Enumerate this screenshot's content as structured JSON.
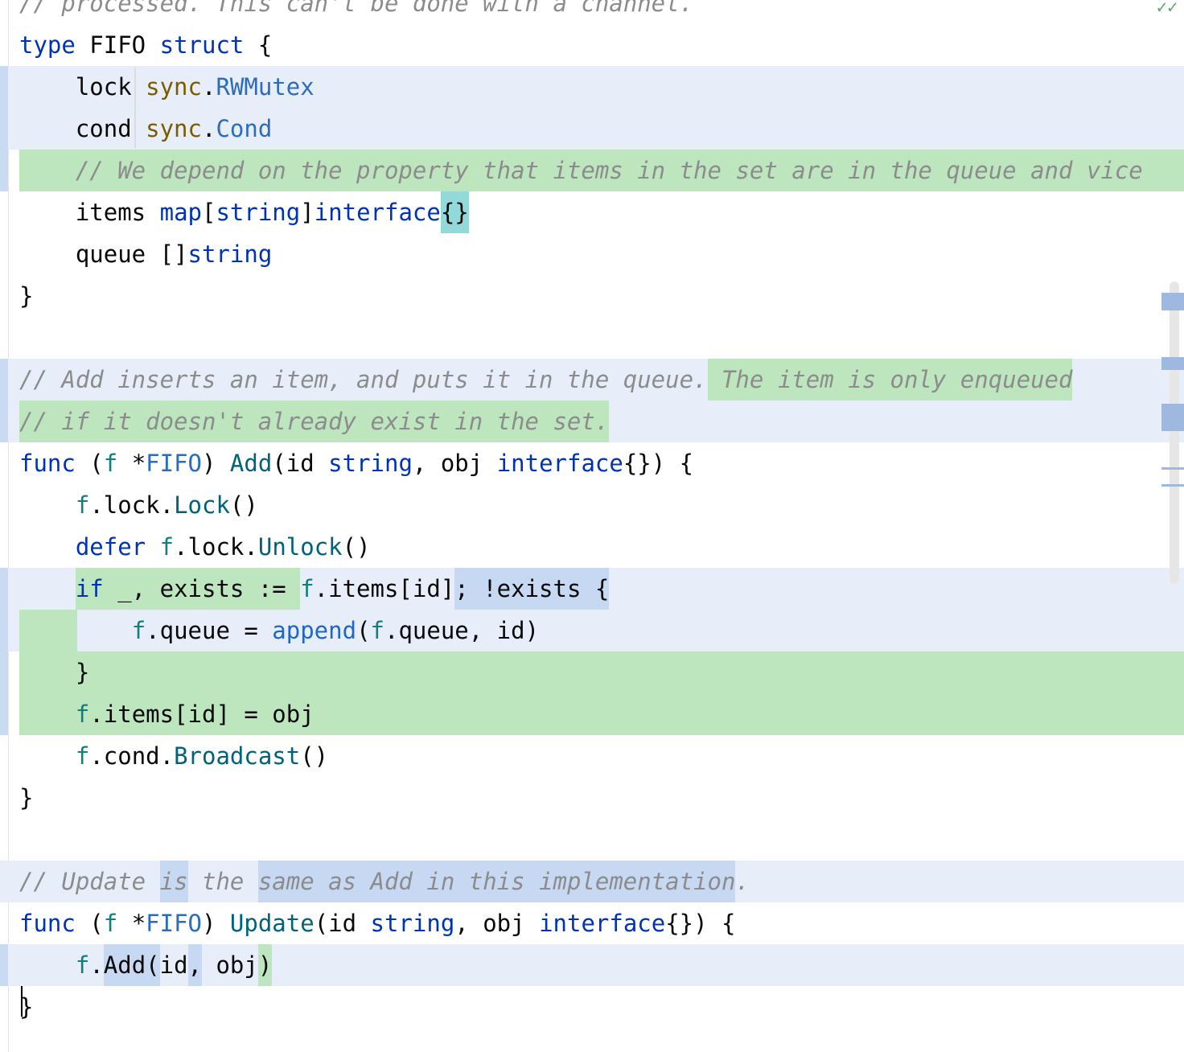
{
  "editor": {
    "status": "✓✓",
    "lines": [
      {
        "id": "l00",
        "tokens": [
          {
            "t": "// processed. This can't be done with a channel.",
            "c": "cm"
          }
        ]
      },
      {
        "id": "l01",
        "tokens": [
          {
            "t": "type",
            "c": "kw"
          },
          {
            "t": " FIFO "
          },
          {
            "t": "struct",
            "c": "kw"
          },
          {
            "t": " {"
          }
        ]
      },
      {
        "id": "l02",
        "tokens": [
          {
            "t": "    lock "
          },
          {
            "t": "sync",
            "c": "pk"
          },
          {
            "t": "."
          },
          {
            "t": "RWMutex",
            "c": "ty"
          }
        ]
      },
      {
        "id": "l03",
        "tokens": [
          {
            "t": "    cond "
          },
          {
            "t": "sync",
            "c": "pk"
          },
          {
            "t": "."
          },
          {
            "t": "Cond",
            "c": "ty"
          }
        ]
      },
      {
        "id": "l04",
        "tokens": [
          {
            "t": "    "
          },
          {
            "t": "// We depend on the property that items in the set are in the queue and vice",
            "c": "cm"
          }
        ]
      },
      {
        "id": "l05",
        "tokens": [
          {
            "t": "    items "
          },
          {
            "t": "map",
            "c": "kw"
          },
          {
            "t": "["
          },
          {
            "t": "string",
            "c": "kw"
          },
          {
            "t": "]"
          },
          {
            "t": "interface",
            "c": "kw"
          },
          {
            "t": "{}",
            "c": "hl-t"
          }
        ]
      },
      {
        "id": "l06",
        "tokens": [
          {
            "t": "    queue []"
          },
          {
            "t": "string",
            "c": "kw"
          }
        ]
      },
      {
        "id": "l07",
        "tokens": [
          {
            "t": "}"
          }
        ]
      },
      {
        "id": "l08",
        "tokens": [
          {
            "t": ""
          }
        ]
      },
      {
        "id": "l09",
        "tokens": [
          {
            "t": "// Add inserts an item, and puts it in the queue.",
            "c": "cm"
          },
          {
            "t": " The item is only enqueued",
            "c": "cm hl-g"
          }
        ]
      },
      {
        "id": "l10",
        "tokens": [
          {
            "t": "// if it doesn't already exist in the set.",
            "c": "cm hl-g"
          }
        ]
      },
      {
        "id": "l11",
        "tokens": [
          {
            "t": "func",
            "c": "kw"
          },
          {
            "t": " ("
          },
          {
            "t": "f",
            "c": "rv"
          },
          {
            "t": " *"
          },
          {
            "t": "FIFO",
            "c": "ty"
          },
          {
            "t": ") "
          },
          {
            "t": "Add",
            "c": "fn"
          },
          {
            "t": "(id "
          },
          {
            "t": "string",
            "c": "kw"
          },
          {
            "t": ", obj "
          },
          {
            "t": "interface",
            "c": "kw"
          },
          {
            "t": "{}) {"
          }
        ]
      },
      {
        "id": "l12",
        "tokens": [
          {
            "t": "    "
          },
          {
            "t": "f",
            "c": "rv"
          },
          {
            "t": ".lock."
          },
          {
            "t": "Lock",
            "c": "fn"
          },
          {
            "t": "()"
          }
        ]
      },
      {
        "id": "l13",
        "tokens": [
          {
            "t": "    "
          },
          {
            "t": "defer",
            "c": "kw"
          },
          {
            "t": " "
          },
          {
            "t": "f",
            "c": "rv"
          },
          {
            "t": ".lock."
          },
          {
            "t": "Unlock",
            "c": "fn"
          },
          {
            "t": "()"
          }
        ]
      },
      {
        "id": "l14",
        "tokens": [
          {
            "t": "    "
          },
          {
            "t": "if",
            "c": "kw hl-g"
          },
          {
            "t": " _, exists := ",
            "c": "hl-g"
          },
          {
            "t": "f",
            "c": "rv"
          },
          {
            "t": ".items[id]"
          },
          {
            "t": "; !exists {",
            "c": "hl-b"
          }
        ]
      },
      {
        "id": "l15",
        "tokens": [
          {
            "t": "        "
          },
          {
            "t": "f",
            "c": "rv"
          },
          {
            "t": ".queue = "
          },
          {
            "t": "append",
            "c": "bi"
          },
          {
            "t": "("
          },
          {
            "t": "f",
            "c": "rv"
          },
          {
            "t": ".queue, id)"
          }
        ]
      },
      {
        "id": "l16",
        "tokens": [
          {
            "t": "    }"
          }
        ]
      },
      {
        "id": "l17",
        "tokens": [
          {
            "t": "    "
          },
          {
            "t": "f",
            "c": "rv"
          },
          {
            "t": ".items[id] = obj"
          }
        ]
      },
      {
        "id": "l18",
        "tokens": [
          {
            "t": "    "
          },
          {
            "t": "f",
            "c": "rv"
          },
          {
            "t": ".cond."
          },
          {
            "t": "Broadcast",
            "c": "fn"
          },
          {
            "t": "()"
          }
        ]
      },
      {
        "id": "l19",
        "tokens": [
          {
            "t": "}"
          }
        ]
      },
      {
        "id": "l20",
        "tokens": [
          {
            "t": ""
          }
        ]
      },
      {
        "id": "l21",
        "tokens": [
          {
            "t": "// Update ",
            "c": "cm"
          },
          {
            "t": "is",
            "c": "cm hl-b"
          },
          {
            "t": " the ",
            "c": "cm"
          },
          {
            "t": "same as Add in this implementation",
            "c": "cm hl-b"
          },
          {
            "t": ".",
            "c": "cm"
          }
        ]
      },
      {
        "id": "l22",
        "tokens": [
          {
            "t": "func",
            "c": "kw"
          },
          {
            "t": " ("
          },
          {
            "t": "f",
            "c": "rv"
          },
          {
            "t": " *"
          },
          {
            "t": "FIFO",
            "c": "ty"
          },
          {
            "t": ") "
          },
          {
            "t": "Update",
            "c": "fn"
          },
          {
            "t": "(id "
          },
          {
            "t": "string",
            "c": "kw"
          },
          {
            "t": ", obj "
          },
          {
            "t": "interface",
            "c": "kw"
          },
          {
            "t": "{}) {"
          }
        ]
      },
      {
        "id": "l23",
        "tokens": [
          {
            "t": "    "
          },
          {
            "t": "f",
            "c": "rv"
          },
          {
            "t": "."
          },
          {
            "t": "Add(",
            "c": "hl-b"
          },
          {
            "t": "id"
          },
          {
            "t": ",",
            "c": "hl-b"
          },
          {
            "t": " obj"
          },
          {
            "t": ")",
            "c": "hl-g"
          }
        ]
      },
      {
        "id": "l24",
        "tokens": [
          {
            "t": "}"
          }
        ]
      }
    ]
  }
}
